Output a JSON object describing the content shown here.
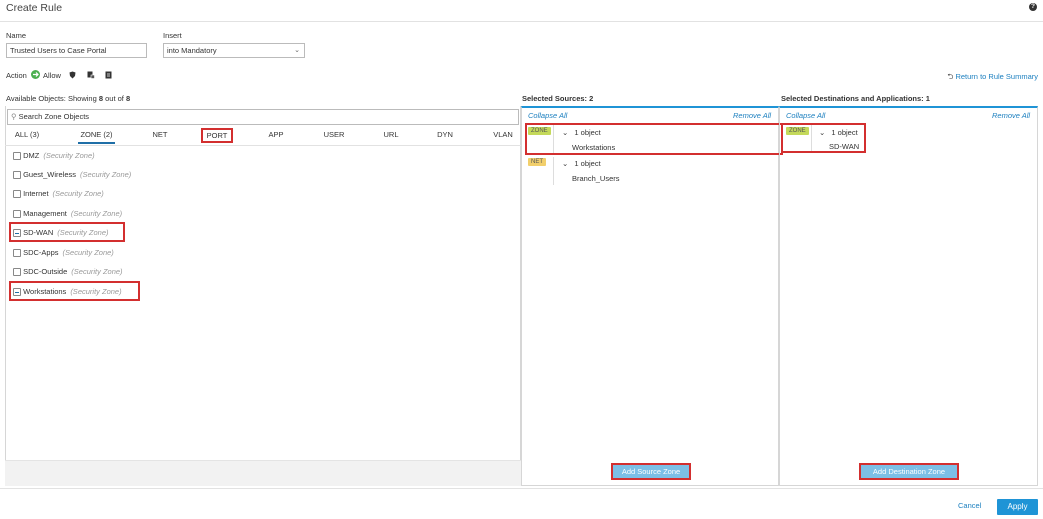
{
  "header": {
    "title": "Create Rule",
    "help_icon": "question-circle-icon",
    "help_glyph": "?"
  },
  "form": {
    "name_label": "Name",
    "name_value": "Trusted Users to Case Portal",
    "insert_label": "Insert",
    "insert_value": "into Mandatory",
    "action_label": "Action",
    "action_value": "Allow",
    "return_link": "Return to Rule Summary"
  },
  "available": {
    "heading_prefix": "Available Objects: Showing",
    "shown": "8",
    "out_of": "out of",
    "total": "8",
    "search_placeholder": "Search Zone Objects",
    "tabs": [
      "ALL (3)",
      "ZONE (2)",
      "NET",
      "PORT",
      "APP",
      "USER",
      "URL",
      "DYN",
      "VLAN"
    ],
    "items": [
      {
        "name": "DMZ",
        "type": "(Security Zone)",
        "checked": false
      },
      {
        "name": "Guest_Wireless",
        "type": "(Security Zone)",
        "checked": false
      },
      {
        "name": "Internet",
        "type": "(Security Zone)",
        "checked": false
      },
      {
        "name": "Management",
        "type": "(Security Zone)",
        "checked": false
      },
      {
        "name": "SD-WAN",
        "type": "(Security Zone)",
        "checked": true
      },
      {
        "name": "SDC-Apps",
        "type": "(Security Zone)",
        "checked": false
      },
      {
        "name": "SDC-Outside",
        "type": "(Security Zone)",
        "checked": false
      },
      {
        "name": "Workstations",
        "type": "(Security Zone)",
        "checked": true
      }
    ]
  },
  "sources": {
    "heading": "Selected Sources: 2",
    "collapse_all": "Collapse All",
    "remove_all": "Remove All",
    "groups": [
      {
        "badge": "ZONE",
        "count": "1 object",
        "item": "Workstations"
      },
      {
        "badge": "NET",
        "count": "1 object",
        "item": "Branch_Users"
      }
    ],
    "add_button": "Add Source Zone"
  },
  "destinations": {
    "heading": "Selected Destinations and Applications: 1",
    "collapse_all": "Collapse All",
    "remove_all": "Remove All",
    "groups": [
      {
        "badge": "ZONE",
        "count": "1 object",
        "item": "SD-WAN"
      }
    ],
    "add_button": "Add Destination Zone"
  },
  "footer": {
    "cancel": "Cancel",
    "apply": "Apply"
  },
  "colors": {
    "accent": "#1f94d6",
    "highlight": "#d32f2f",
    "zone_badge": "#c4d95a",
    "net_badge": "#f2cf6b"
  }
}
